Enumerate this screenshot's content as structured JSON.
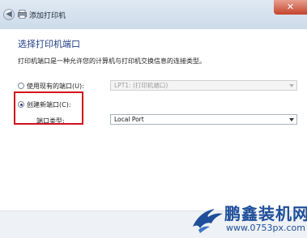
{
  "window": {
    "title": "添加打印机",
    "close_label": "✕"
  },
  "page": {
    "heading": "选择打印机端口",
    "description": "打印机端口是一种允许您的计算机与打印机交换信息的连接类型。"
  },
  "options": {
    "use_existing": {
      "label": "使用现有的端口(U):",
      "selected": false,
      "dropdown_value": "LPT1: (打印机端口)",
      "dropdown_enabled": false
    },
    "create_new": {
      "label": "创建新端口(C):",
      "selected": true,
      "port_type_label": "端口类型:",
      "port_type_value": "Local Port"
    }
  },
  "watermark": {
    "brand": "鹏鑫装机网",
    "url": "www.0753px.com"
  },
  "colors": {
    "heading": "#1f3d86",
    "highlight": "#d0101c",
    "watermark": "#1f4f9a"
  }
}
